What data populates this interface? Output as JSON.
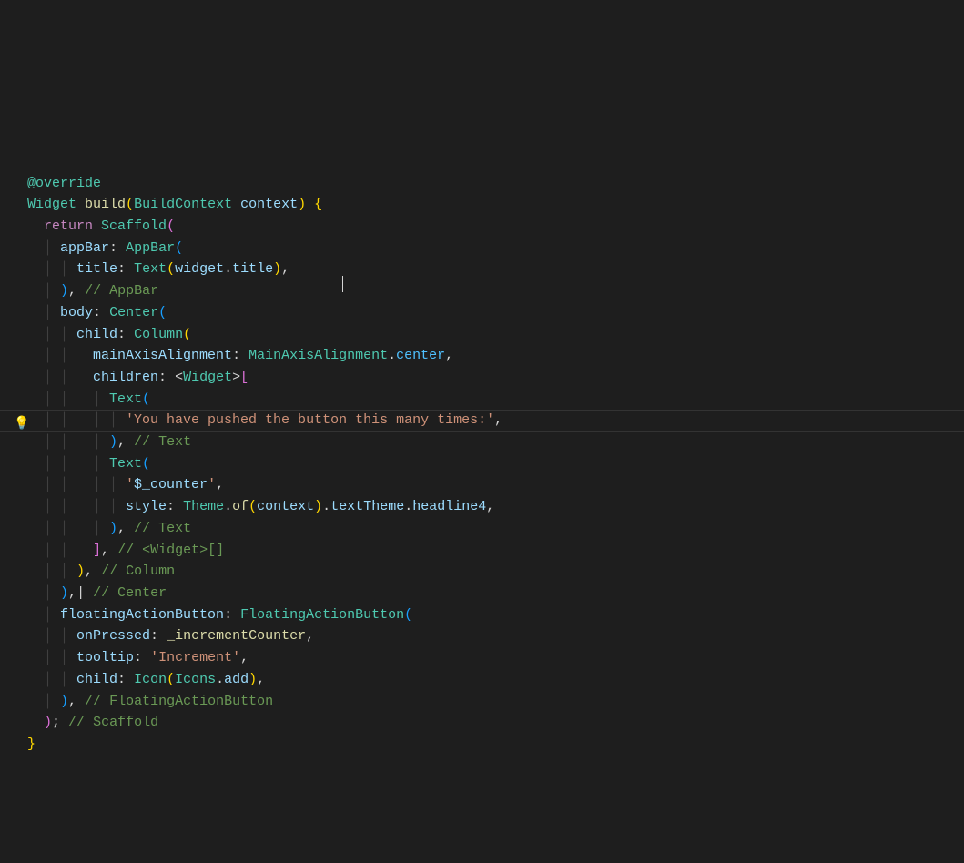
{
  "annotation": "@override",
  "line2": {
    "widget": "Widget",
    "build": "build",
    "buildContext": "BuildContext",
    "context": "context"
  },
  "ret": "return",
  "scaffold": "Scaffold",
  "appBarProp": "appBar",
  "appBarClass": "AppBar",
  "titleProp": "title",
  "textClass": "Text",
  "widgetVar": "widget",
  "titleField": "title",
  "commentAppBar": "// AppBar",
  "bodyProp": "body",
  "centerClass": "Center",
  "childProp": "child",
  "columnClass": "Column",
  "mainAxisProp": "mainAxisAlignment",
  "mainAxisClass": "MainAxisAlignment",
  "centerEnum": "center",
  "childrenProp": "children",
  "widgetType": "Widget",
  "string1": "'You have pushed the button this many times:'",
  "commentText": "// Text",
  "string2a": "'",
  "string2b": "$_counter",
  "string2c": "'",
  "styleProp": "style",
  "themeClass": "Theme",
  "ofMethod": "of",
  "contextParam": "context",
  "textThemeProp": "textTheme",
  "headline4Prop": "headline4",
  "commentWidgetList": "// <Widget>[]",
  "commentColumn": "// Column",
  "commentCenter": "// Center",
  "fabProp": "floatingActionButton",
  "fabClass": "FloatingActionButton",
  "onPressedProp": "onPressed",
  "incrementCounter": "_incrementCounter",
  "tooltipProp": "tooltip",
  "incrementStr": "'Increment'",
  "iconClass": "Icon",
  "iconsClass": "Icons",
  "addProp": "add",
  "commentFab": "// FloatingActionButton",
  "commentScaffold": "// Scaffold"
}
